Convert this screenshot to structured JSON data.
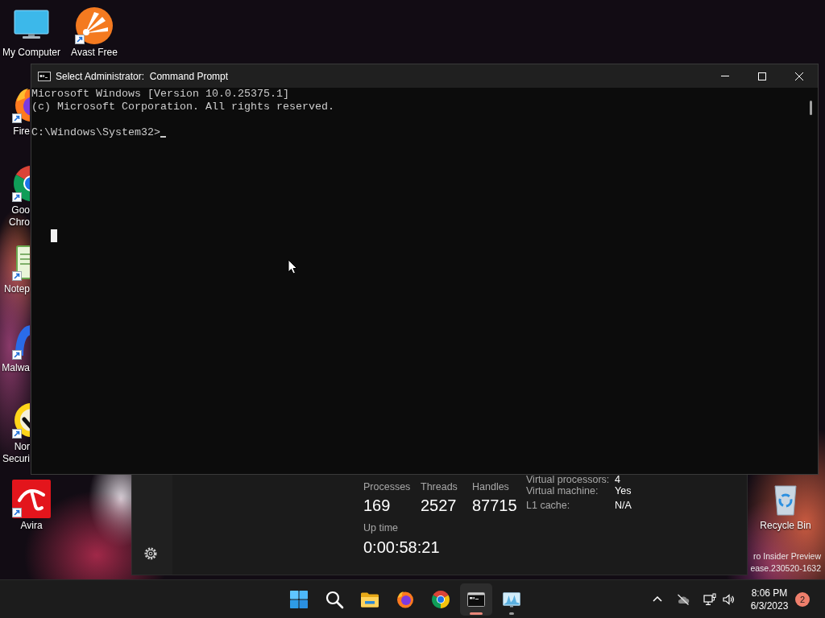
{
  "desktop": {
    "icon_columns": [
      [
        {
          "label": [
            "My Computer"
          ],
          "kind": "monitor",
          "shortcut": false,
          "covered": false
        },
        {
          "label": [
            "Fire"
          ],
          "kind": "flame_globe",
          "shortcut": true,
          "covered": true
        },
        {
          "label": [
            "Goo",
            "Chro"
          ],
          "kind": "ring",
          "shortcut": true,
          "covered": true
        },
        {
          "label": [
            "Notep"
          ],
          "kind": "notepad",
          "shortcut": true,
          "covered": true
        },
        {
          "label": [
            "Malwa"
          ],
          "kind": "wing",
          "shortcut": true,
          "covered": true
        },
        {
          "label": [
            "Nor",
            "Securi"
          ],
          "kind": "check",
          "shortcut": true,
          "covered": true
        },
        {
          "label": [
            "Avira"
          ],
          "kind": "umbrella",
          "shortcut": true,
          "covered": false
        }
      ],
      [
        {
          "label": [
            "Avast Free"
          ],
          "kind": "rays",
          "shortcut": true,
          "covered": false
        }
      ]
    ],
    "recycle_bin": {
      "label": [
        "Recycle Bin"
      ],
      "kind": "bin",
      "shortcut": false,
      "covered": false
    },
    "watermark": [
      "ro Insider Preview",
      "ease.230520-1632"
    ]
  },
  "command_prompt": {
    "title": "Select Administrator:  Command Prompt",
    "output": [
      "Microsoft Windows [Version 10.0.25375.1]",
      "(c) Microsoft Corporation. All rights reserved."
    ],
    "prompt": "C:\\Windows\\System32>"
  },
  "task_manager": {
    "stats": [
      {
        "label": "Processes",
        "value": "169"
      },
      {
        "label": "Threads",
        "value": "2527"
      },
      {
        "label": "Handles",
        "value": "87715"
      }
    ],
    "uptime": {
      "label": "Up time",
      "value": "0:00:58:21"
    },
    "details": [
      {
        "label": "Virtual processors:",
        "value": "4"
      },
      {
        "label": "Virtual machine:",
        "value": "Yes"
      },
      {
        "label": "L1 cache:",
        "value": "N/A"
      }
    ]
  },
  "taskbar": {
    "apps": [
      {
        "kind": "grid",
        "selected": false,
        "running": false
      },
      {
        "kind": "search",
        "selected": false,
        "running": false
      },
      {
        "kind": "folder",
        "selected": false,
        "running": false
      },
      {
        "kind": "flame_globe",
        "selected": false,
        "running": false
      },
      {
        "kind": "ring",
        "selected": false,
        "running": false
      },
      {
        "kind": "terminal",
        "selected": true,
        "running": true
      },
      {
        "kind": "graph",
        "selected": false,
        "running": true
      }
    ],
    "clock": {
      "time": "8:06 PM",
      "date": "6/3/2023"
    },
    "notifications": "2"
  }
}
